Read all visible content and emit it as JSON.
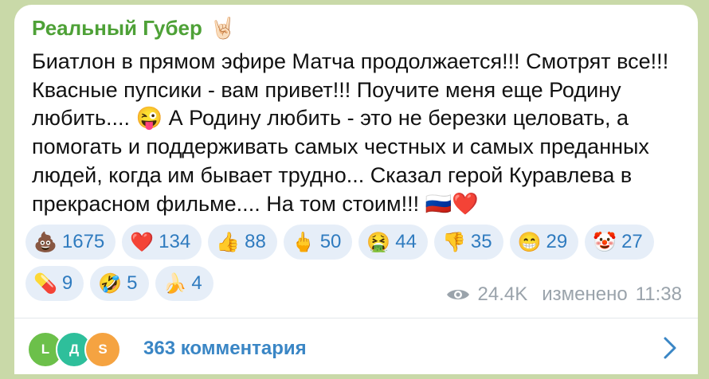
{
  "channel": {
    "title": "Реальный Губер",
    "title_emoji": "🤘🏻"
  },
  "message": {
    "text_part1": "Биатлон в прямом эфире Матча продолжается!!! Смотрят все!!! Квасные пупсики - вам привет!!! Поучите меня еще Родину любить.... ",
    "emoji_wink": "😜",
    "text_part2": " А Родину любить - это не березки целовать, а помогать и поддерживать самых честных и самых преданных людей, когда им бывает трудно... Сказал герой Куравлева в прекрасном фильме.... На том стоим!!! ",
    "emoji_flag": "🇷🇺",
    "emoji_heart": "❤️"
  },
  "reactions": [
    {
      "emoji": "💩",
      "count": "1675"
    },
    {
      "emoji": "❤️",
      "count": "134"
    },
    {
      "emoji": "👍",
      "count": "88"
    },
    {
      "emoji": "🖕",
      "count": "50"
    },
    {
      "emoji": "🤮",
      "count": "44"
    },
    {
      "emoji": "👎",
      "count": "35"
    },
    {
      "emoji": "😁",
      "count": "29"
    },
    {
      "emoji": "🤡",
      "count": "27"
    },
    {
      "emoji": "💊",
      "count": "9"
    },
    {
      "emoji": "🤣",
      "count": "5"
    },
    {
      "emoji": "🍌",
      "count": "4"
    }
  ],
  "meta": {
    "views": "24.4K",
    "edited_label": "изменено",
    "time": "11:38",
    "views_icon": "eye-icon"
  },
  "comments": {
    "label": "363 комментария",
    "avatars": [
      {
        "letter": "L",
        "color": "#6cc04a"
      },
      {
        "letter": "Д",
        "color": "#2ebf9b"
      },
      {
        "letter": "S",
        "color": "#f5a341"
      }
    ],
    "arrow_icon": "chevron-right-icon"
  },
  "colors": {
    "author": "#4ea137",
    "reaction_bg": "#e6eef8",
    "reaction_text": "#2f7bbf",
    "link": "#3a86c5",
    "meta": "#9aa3ab",
    "background": "#c9d9a8"
  }
}
